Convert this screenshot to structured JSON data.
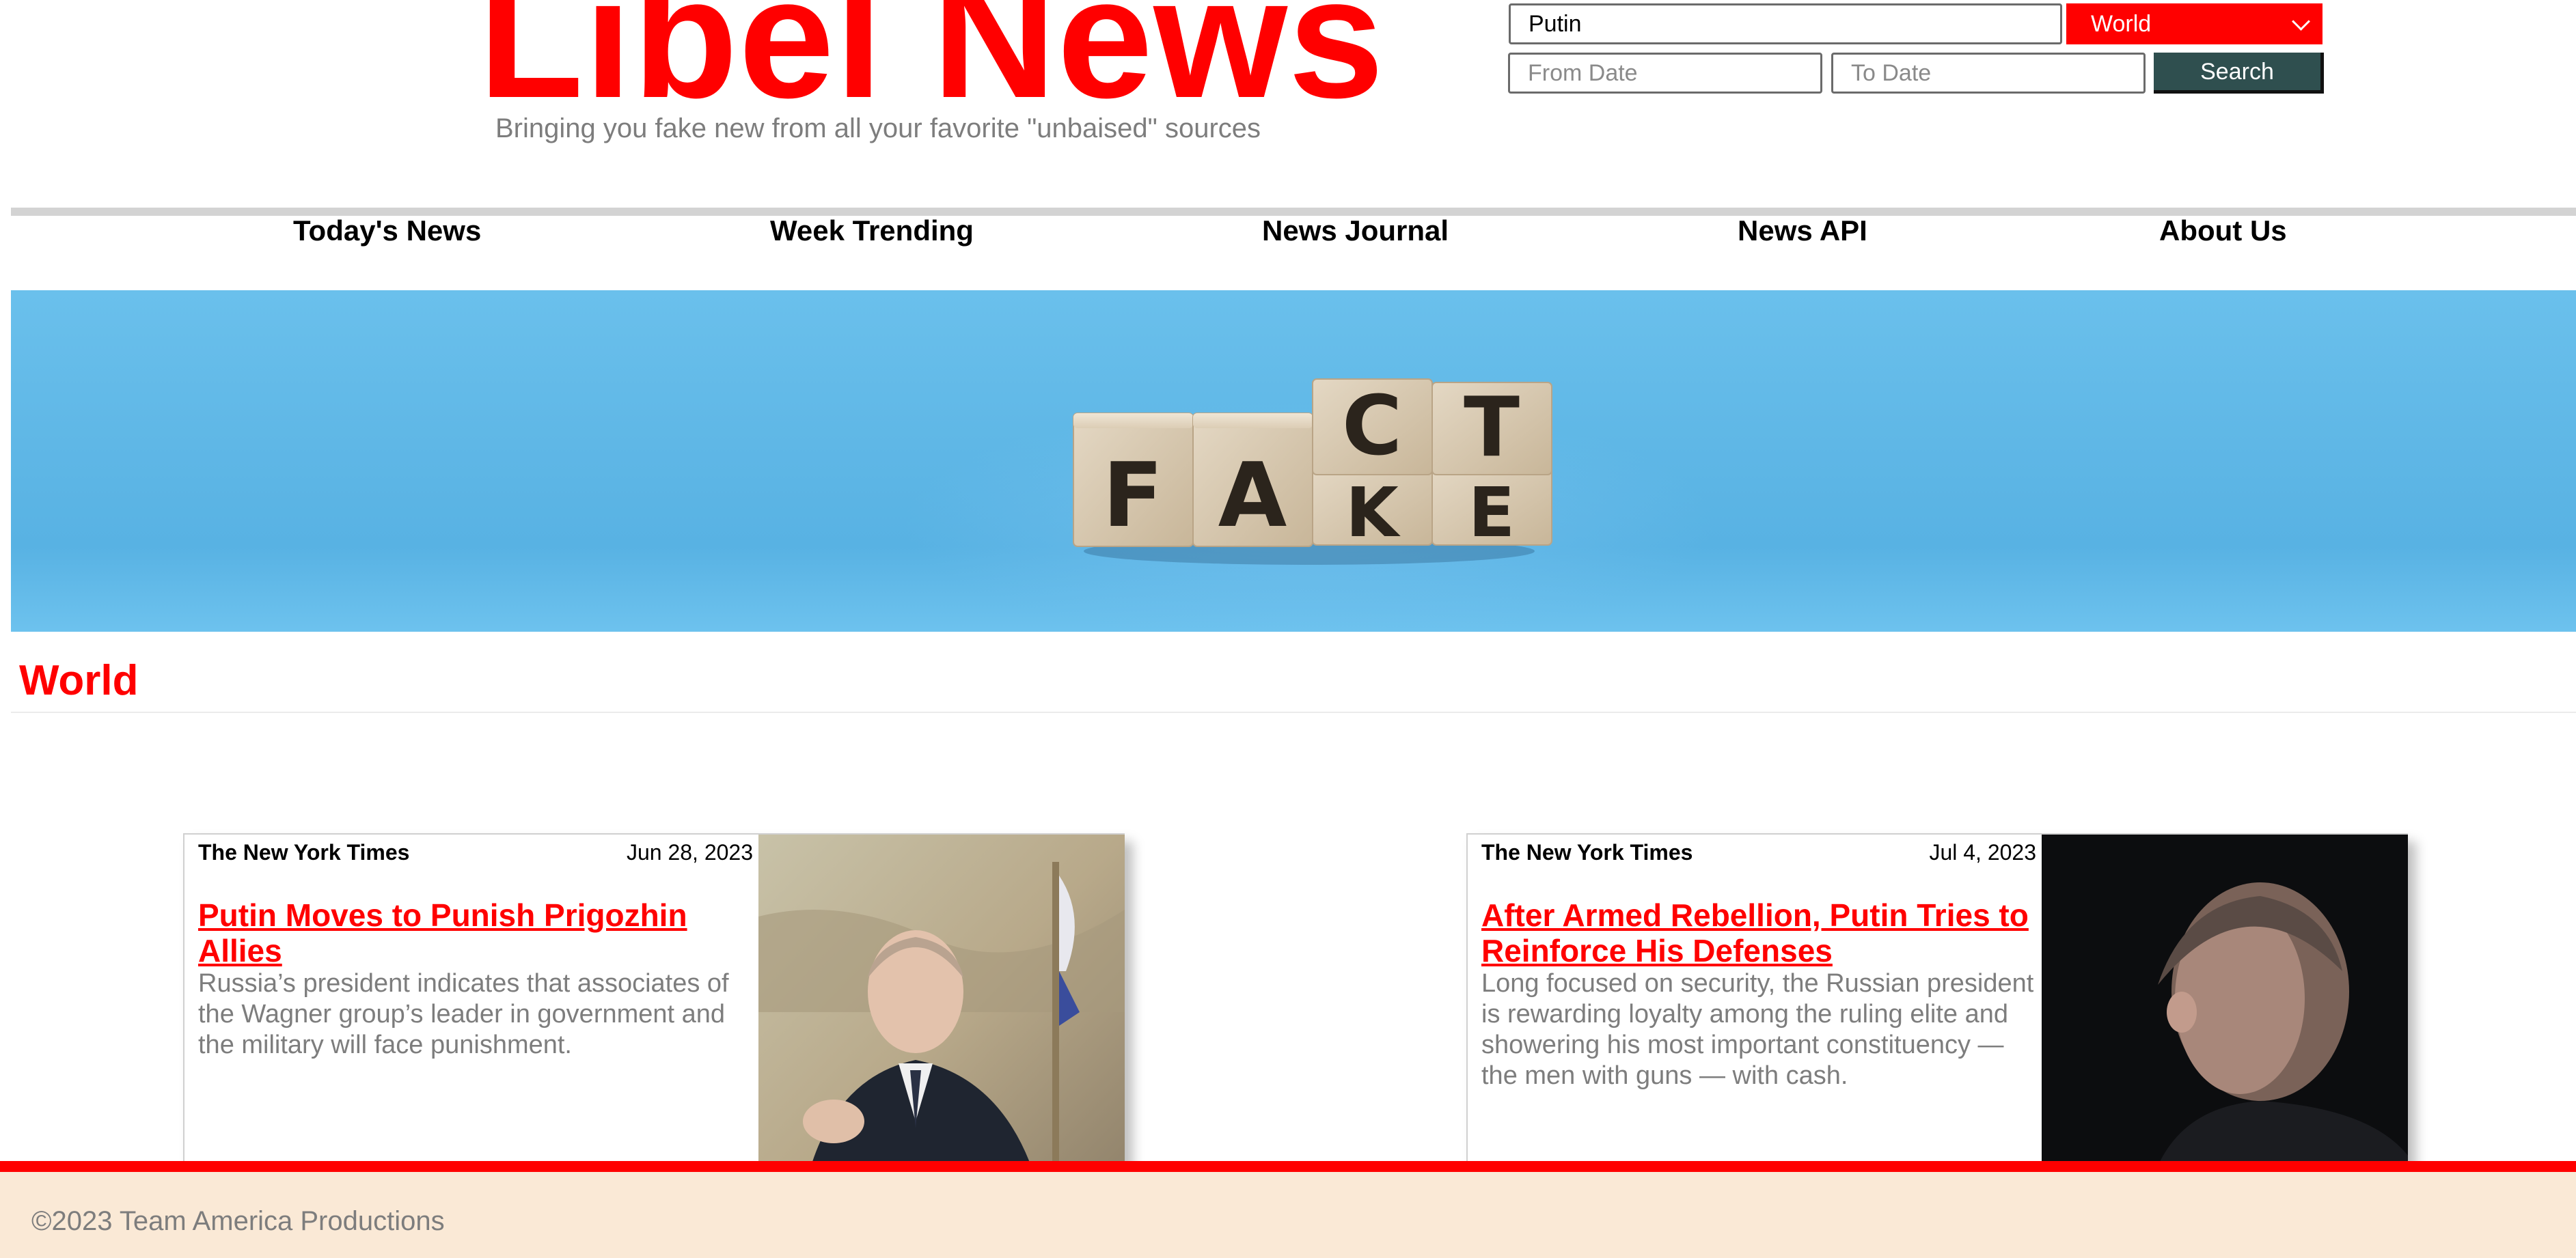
{
  "header": {
    "logo": "Libel News",
    "tagline": "Bringing you fake new from all your favorite \"unbaised\" sources"
  },
  "search": {
    "query": "Putin",
    "category": "World",
    "from_placeholder": "From Date",
    "to_placeholder": "To Date",
    "button_label": "Search"
  },
  "nav": {
    "items": [
      {
        "label": "Today's News"
      },
      {
        "label": "Week Trending"
      },
      {
        "label": "News Journal"
      },
      {
        "label": "News API"
      },
      {
        "label": "About Us"
      }
    ]
  },
  "banner": {
    "top_letters": [
      "C",
      "T"
    ],
    "bottom_letters": [
      "F",
      "A",
      "K",
      "E"
    ],
    "background_color": "#5fb7e6"
  },
  "section": {
    "title": "World"
  },
  "articles": [
    {
      "source": "The New York Times",
      "date": "Jun 28, 2023",
      "headline": "Putin Moves to Punish Prigozhin Allies",
      "summary": "Russia’s president indicates that associates of the Wagner group’s leader in government and the military will face punishment."
    },
    {
      "source": "The New York Times",
      "date": "Jul 4, 2023",
      "headline": "After Armed Rebellion, Putin Tries to Reinforce His Defenses",
      "summary": "Long focused on security, the Russian president is rewarding loyalty among the ruling elite and showering his most important constituency — the men with guns — with cash."
    }
  ],
  "footer": {
    "text": "©2023 Team America Productions"
  },
  "colors": {
    "accent": "#ff0000",
    "button": "#2f4f4f",
    "footer_bg": "#fae9d6",
    "muted_text": "#7d7d7d"
  }
}
